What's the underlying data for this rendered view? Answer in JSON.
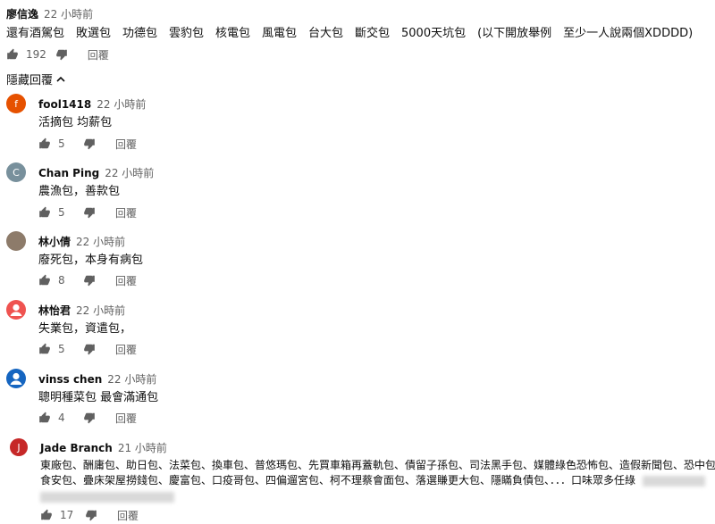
{
  "top_comment": {
    "author": "廖信逸",
    "time": "22 小時前",
    "text": "還有酒駕包　敗選包　功德包　雲豹包　核電包　風電包　台大包　斷交包　5000天坑包　(以下開放舉例　至少一人說兩個XDDDD)",
    "likes": "192",
    "reply_label": "回覆"
  },
  "toggle_label": "隱藏回覆",
  "replies": [
    {
      "author": "fool1418",
      "time": "22 小時前",
      "text": "活摘包 均薪包",
      "likes": "5",
      "reply_label": "回覆",
      "avatar_letter": "f",
      "avatar_color": "#e65100"
    },
    {
      "author": "Chan Ping",
      "time": "22 小時前",
      "text": "農漁包，善款包",
      "likes": "5",
      "reply_label": "回覆",
      "avatar_letter": "C",
      "avatar_color": "#78909c"
    },
    {
      "author": "林小倩",
      "time": "22 小時前",
      "text": "廢死包，本身有病包",
      "likes": "8",
      "reply_label": "回覆",
      "avatar_letter": "",
      "avatar_color": "#8d7b6a"
    },
    {
      "author": "林怡君",
      "time": "22 小時前",
      "text": "失業包，資遣包，",
      "likes": "5",
      "reply_label": "回覆",
      "avatar_letter": "",
      "avatar_color": "#ef5350"
    },
    {
      "author": "vinss chen",
      "time": "22 小時前",
      "text": "聰明種菜包 最會滿通包",
      "likes": "4",
      "reply_label": "回覆",
      "avatar_letter": "",
      "avatar_color": "#1565c0"
    },
    {
      "author": "Jade Branch",
      "time": "21 小時前",
      "text_line1": "東廠包、酬庸包、助日包、法菜包、換車包、普悠瑪包、先買車箱再蓋軌包、債留子孫包、司法黑手包、媒體綠色恐怖包、造假新聞包、恐中包、",
      "text_line2": "食安包、疊床架屋撈錢包、慶富包、口疫哥包、四偏遛宮包、柯不理蔡會面包、落選賺更大包、隱瞞負債包、．．．口味眾多任綠",
      "likes": "17",
      "reply_label": "回覆",
      "avatar_letter": "J",
      "avatar_color": "#c62828"
    }
  ]
}
